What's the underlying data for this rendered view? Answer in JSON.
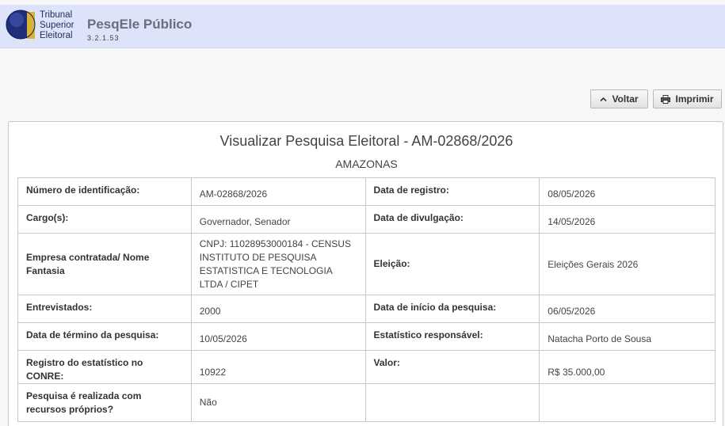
{
  "header": {
    "logo_lines": [
      "Tribunal",
      "Superior",
      "Eleitoral"
    ],
    "app_title": "PesqEle Público",
    "version": "3.2.1.53"
  },
  "toolbar": {
    "back_label": "Voltar",
    "back_icon": "chevron-up-icon",
    "print_label": "Imprimir",
    "print_icon": "printer-icon"
  },
  "panel": {
    "title": "Visualizar Pesquisa Eleitoral - AM-02868/2026",
    "subtitle": "AMAZONAS"
  },
  "details": {
    "rows": [
      [
        {
          "label": "Número de identificação:",
          "value": "AM-02868/2026"
        },
        {
          "label": "Data de registro:",
          "value": "08/05/2026"
        }
      ],
      [
        {
          "label": "Cargo(s):",
          "value": "Governador, Senador"
        },
        {
          "label": "Data de divulgação:",
          "value": "14/05/2026"
        }
      ],
      [
        {
          "label": "Empresa contratada/ Nome Fantasia",
          "value": "CNPJ: 11028953000184 - CENSUS INSTITUTO DE PESQUISA ESTATISTICA E TECNOLOGIA LTDA / CIPET"
        },
        {
          "label": "Eleição:",
          "value": "Eleições Gerais 2026"
        }
      ],
      [
        {
          "label": "Entrevistados:",
          "value": "2000"
        },
        {
          "label": "Data de início da pesquisa:",
          "value": "06/05/2026"
        }
      ],
      [
        {
          "label": "Data de término da pesquisa:",
          "value": "10/05/2026"
        },
        {
          "label": "Estatístico responsável:",
          "value": "Natacha Porto de Sousa"
        }
      ],
      [
        {
          "label": "Registro do estatístico no CONRE:",
          "value": "10922"
        },
        {
          "label": "Valor:",
          "value": "R$ 35.000,00"
        }
      ],
      [
        {
          "label": "Pesquisa é realizada com recursos próprios?",
          "value": "Não"
        },
        {
          "label": "",
          "value": ""
        }
      ]
    ]
  },
  "colors": {
    "header_bg": "#dde3f8",
    "logo_blue": "#1f2d7a",
    "logo_gold": "#d9b23a",
    "title_gray": "#66707f"
  }
}
